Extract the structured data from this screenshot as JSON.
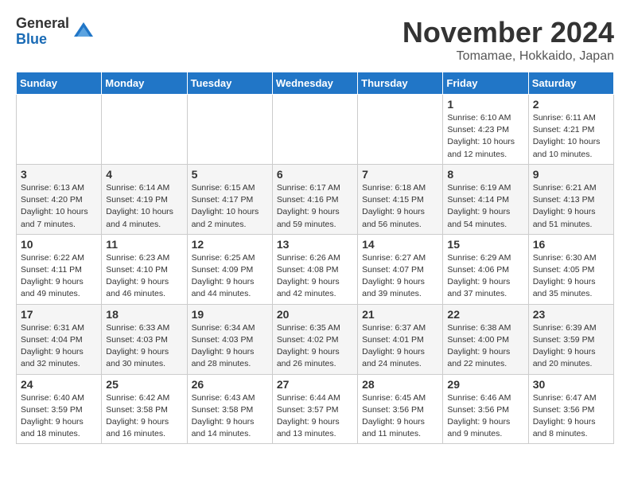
{
  "logo": {
    "general": "General",
    "blue": "Blue"
  },
  "title": "November 2024",
  "location": "Tomamae, Hokkaido, Japan",
  "days_of_week": [
    "Sunday",
    "Monday",
    "Tuesday",
    "Wednesday",
    "Thursday",
    "Friday",
    "Saturday"
  ],
  "weeks": [
    [
      {
        "day": "",
        "info": ""
      },
      {
        "day": "",
        "info": ""
      },
      {
        "day": "",
        "info": ""
      },
      {
        "day": "",
        "info": ""
      },
      {
        "day": "",
        "info": ""
      },
      {
        "day": "1",
        "info": "Sunrise: 6:10 AM\nSunset: 4:23 PM\nDaylight: 10 hours and 12 minutes."
      },
      {
        "day": "2",
        "info": "Sunrise: 6:11 AM\nSunset: 4:21 PM\nDaylight: 10 hours and 10 minutes."
      }
    ],
    [
      {
        "day": "3",
        "info": "Sunrise: 6:13 AM\nSunset: 4:20 PM\nDaylight: 10 hours and 7 minutes."
      },
      {
        "day": "4",
        "info": "Sunrise: 6:14 AM\nSunset: 4:19 PM\nDaylight: 10 hours and 4 minutes."
      },
      {
        "day": "5",
        "info": "Sunrise: 6:15 AM\nSunset: 4:17 PM\nDaylight: 10 hours and 2 minutes."
      },
      {
        "day": "6",
        "info": "Sunrise: 6:17 AM\nSunset: 4:16 PM\nDaylight: 9 hours and 59 minutes."
      },
      {
        "day": "7",
        "info": "Sunrise: 6:18 AM\nSunset: 4:15 PM\nDaylight: 9 hours and 56 minutes."
      },
      {
        "day": "8",
        "info": "Sunrise: 6:19 AM\nSunset: 4:14 PM\nDaylight: 9 hours and 54 minutes."
      },
      {
        "day": "9",
        "info": "Sunrise: 6:21 AM\nSunset: 4:13 PM\nDaylight: 9 hours and 51 minutes."
      }
    ],
    [
      {
        "day": "10",
        "info": "Sunrise: 6:22 AM\nSunset: 4:11 PM\nDaylight: 9 hours and 49 minutes."
      },
      {
        "day": "11",
        "info": "Sunrise: 6:23 AM\nSunset: 4:10 PM\nDaylight: 9 hours and 46 minutes."
      },
      {
        "day": "12",
        "info": "Sunrise: 6:25 AM\nSunset: 4:09 PM\nDaylight: 9 hours and 44 minutes."
      },
      {
        "day": "13",
        "info": "Sunrise: 6:26 AM\nSunset: 4:08 PM\nDaylight: 9 hours and 42 minutes."
      },
      {
        "day": "14",
        "info": "Sunrise: 6:27 AM\nSunset: 4:07 PM\nDaylight: 9 hours and 39 minutes."
      },
      {
        "day": "15",
        "info": "Sunrise: 6:29 AM\nSunset: 4:06 PM\nDaylight: 9 hours and 37 minutes."
      },
      {
        "day": "16",
        "info": "Sunrise: 6:30 AM\nSunset: 4:05 PM\nDaylight: 9 hours and 35 minutes."
      }
    ],
    [
      {
        "day": "17",
        "info": "Sunrise: 6:31 AM\nSunset: 4:04 PM\nDaylight: 9 hours and 32 minutes."
      },
      {
        "day": "18",
        "info": "Sunrise: 6:33 AM\nSunset: 4:03 PM\nDaylight: 9 hours and 30 minutes."
      },
      {
        "day": "19",
        "info": "Sunrise: 6:34 AM\nSunset: 4:03 PM\nDaylight: 9 hours and 28 minutes."
      },
      {
        "day": "20",
        "info": "Sunrise: 6:35 AM\nSunset: 4:02 PM\nDaylight: 9 hours and 26 minutes."
      },
      {
        "day": "21",
        "info": "Sunrise: 6:37 AM\nSunset: 4:01 PM\nDaylight: 9 hours and 24 minutes."
      },
      {
        "day": "22",
        "info": "Sunrise: 6:38 AM\nSunset: 4:00 PM\nDaylight: 9 hours and 22 minutes."
      },
      {
        "day": "23",
        "info": "Sunrise: 6:39 AM\nSunset: 3:59 PM\nDaylight: 9 hours and 20 minutes."
      }
    ],
    [
      {
        "day": "24",
        "info": "Sunrise: 6:40 AM\nSunset: 3:59 PM\nDaylight: 9 hours and 18 minutes."
      },
      {
        "day": "25",
        "info": "Sunrise: 6:42 AM\nSunset: 3:58 PM\nDaylight: 9 hours and 16 minutes."
      },
      {
        "day": "26",
        "info": "Sunrise: 6:43 AM\nSunset: 3:58 PM\nDaylight: 9 hours and 14 minutes."
      },
      {
        "day": "27",
        "info": "Sunrise: 6:44 AM\nSunset: 3:57 PM\nDaylight: 9 hours and 13 minutes."
      },
      {
        "day": "28",
        "info": "Sunrise: 6:45 AM\nSunset: 3:56 PM\nDaylight: 9 hours and 11 minutes."
      },
      {
        "day": "29",
        "info": "Sunrise: 6:46 AM\nSunset: 3:56 PM\nDaylight: 9 hours and 9 minutes."
      },
      {
        "day": "30",
        "info": "Sunrise: 6:47 AM\nSunset: 3:56 PM\nDaylight: 9 hours and 8 minutes."
      }
    ]
  ]
}
